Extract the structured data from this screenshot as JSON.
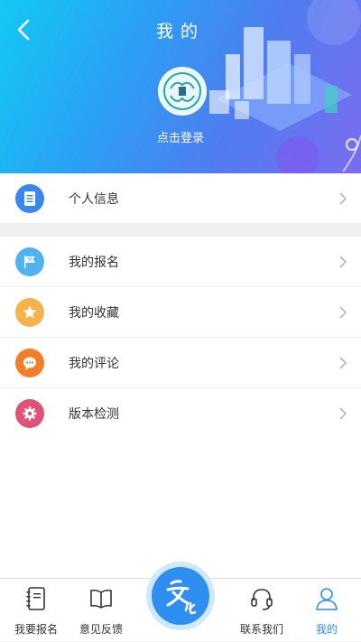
{
  "header": {
    "title": "我的",
    "login_label": "点击登录"
  },
  "menu": {
    "profile": {
      "label": "个人信息",
      "icon": "document-icon",
      "color": "#3a86ef"
    },
    "items": [
      {
        "label": "我的报名",
        "icon": "flag-icon",
        "color": "#4fb3f2"
      },
      {
        "label": "我的收藏",
        "icon": "star-icon",
        "color": "#f6b24b"
      },
      {
        "label": "我的评论",
        "icon": "chat-icon",
        "color": "#f47d2a"
      },
      {
        "label": "版本检测",
        "icon": "gear-icon",
        "color": "#e05374"
      }
    ]
  },
  "tabbar": {
    "tabs": [
      {
        "label": "我要报名",
        "icon": "notebook-icon"
      },
      {
        "label": "意见反馈",
        "icon": "book-icon"
      },
      {
        "label": "联系我们",
        "icon": "headset-icon"
      },
      {
        "label": "我的",
        "icon": "user-icon",
        "active": true
      }
    ],
    "center_icon": "culture-logo-icon",
    "active_color": "#2b8ef2"
  }
}
